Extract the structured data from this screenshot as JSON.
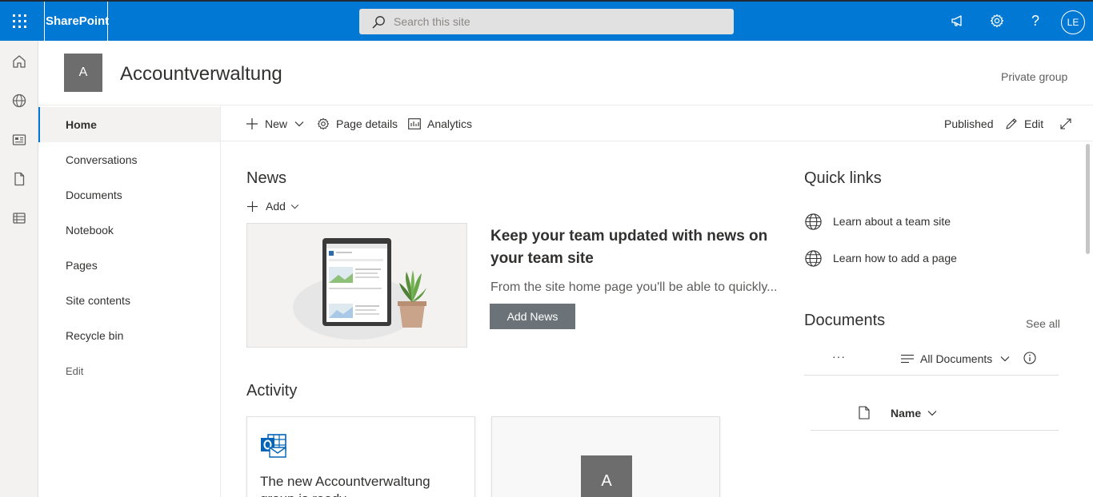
{
  "suite": {
    "brand": "SharePoint",
    "search_placeholder": "Search this site",
    "user_initials": "LE"
  },
  "appbar": {
    "icons": [
      "home-icon",
      "globe-icon",
      "news-icon",
      "file-icon",
      "list-icon"
    ]
  },
  "site": {
    "logo_letter": "A",
    "title": "Accountverwaltung",
    "privacy": "Private group"
  },
  "leftnav": {
    "items": [
      {
        "label": "Home"
      },
      {
        "label": "Conversations"
      },
      {
        "label": "Documents"
      },
      {
        "label": "Notebook"
      },
      {
        "label": "Pages"
      },
      {
        "label": "Site contents"
      },
      {
        "label": "Recycle bin"
      }
    ],
    "edit_label": "Edit"
  },
  "commandbar": {
    "new_label": "New",
    "page_details_label": "Page details",
    "analytics_label": "Analytics",
    "status": "Published",
    "edit_label": "Edit"
  },
  "news": {
    "heading": "News",
    "add_label": "Add",
    "title": "Keep your team updated with news on your team site",
    "description": "From the site home page you'll be able to quickly...",
    "button_label": "Add News"
  },
  "activity": {
    "heading": "Activity",
    "card1_text": "The new Accountverwaltung group is ready",
    "card2_letter": "A"
  },
  "quicklinks": {
    "heading": "Quick links",
    "items": [
      {
        "label": "Learn about a team site"
      },
      {
        "label": "Learn how to add a page"
      }
    ]
  },
  "documents": {
    "heading": "Documents",
    "see_all": "See all",
    "more": "···",
    "view_label": "All Documents",
    "col_name": "Name"
  },
  "colors": {
    "suite_bar": "#0078d4",
    "nav_active_bg": "#f3f2f1",
    "button_bg": "#6b7378"
  }
}
